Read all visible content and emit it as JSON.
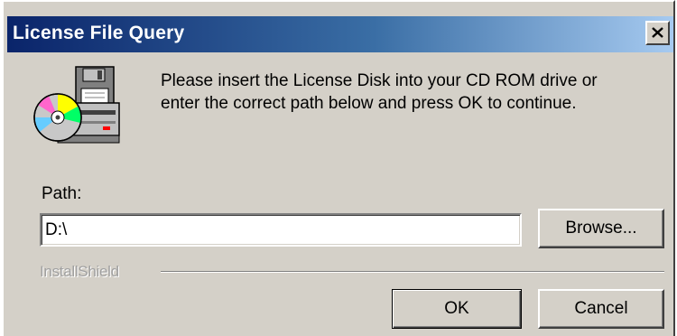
{
  "window": {
    "title": "License File Query",
    "close_icon": "close-x-icon"
  },
  "icon": "license-disk-icon",
  "message": {
    "line1": "Please insert the License Disk into your CD ROM drive or",
    "line2": "enter the correct path below and press OK to continue."
  },
  "path": {
    "label": "Path:",
    "value": "D:\\"
  },
  "buttons": {
    "browse": "Browse...",
    "ok": "OK",
    "cancel": "Cancel"
  },
  "brand": "InstallShield",
  "colors": {
    "dialog_bg": "#d4d0c8",
    "titlebar_start": "#0a246a",
    "titlebar_end": "#a6caf0"
  }
}
